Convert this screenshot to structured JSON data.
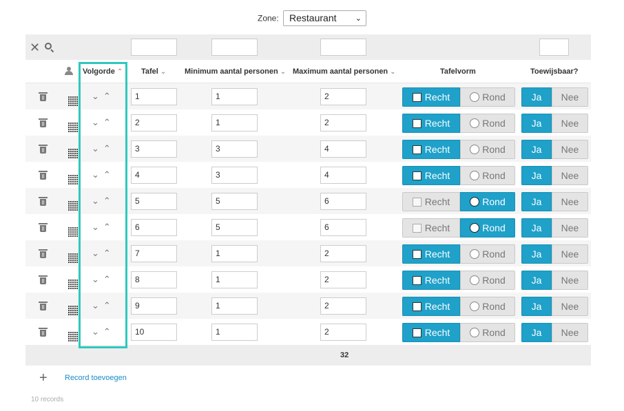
{
  "zone": {
    "label": "Zone:",
    "selected": "Restaurant"
  },
  "headers": {
    "volgorde": "Volgorde",
    "tafel": "Tafel",
    "min": "Minimum aantal personen",
    "max": "Maximum aantal personen",
    "tafelvorm": "Tafelvorm",
    "toewijsbaar": "Toewijsbaar?"
  },
  "options": {
    "recht": "Recht",
    "rond": "Rond",
    "ja": "Ja",
    "nee": "Nee"
  },
  "rows": [
    {
      "tafel": "1",
      "min": "1",
      "max": "2",
      "vorm": "Recht",
      "toewijsbaar": "Ja"
    },
    {
      "tafel": "2",
      "min": "1",
      "max": "2",
      "vorm": "Recht",
      "toewijsbaar": "Ja"
    },
    {
      "tafel": "3",
      "min": "3",
      "max": "4",
      "vorm": "Recht",
      "toewijsbaar": "Ja"
    },
    {
      "tafel": "4",
      "min": "3",
      "max": "4",
      "vorm": "Recht",
      "toewijsbaar": "Ja"
    },
    {
      "tafel": "5",
      "min": "5",
      "max": "6",
      "vorm": "Rond",
      "toewijsbaar": "Ja"
    },
    {
      "tafel": "6",
      "min": "5",
      "max": "6",
      "vorm": "Rond",
      "toewijsbaar": "Ja"
    },
    {
      "tafel": "7",
      "min": "1",
      "max": "2",
      "vorm": "Recht",
      "toewijsbaar": "Ja"
    },
    {
      "tafel": "8",
      "min": "1",
      "max": "2",
      "vorm": "Recht",
      "toewijsbaar": "Ja"
    },
    {
      "tafel": "9",
      "min": "1",
      "max": "2",
      "vorm": "Recht",
      "toewijsbaar": "Ja"
    },
    {
      "tafel": "10",
      "min": "1",
      "max": "2",
      "vorm": "Recht",
      "toewijsbaar": "Ja"
    }
  ],
  "footer": {
    "total": "32"
  },
  "add_record": "Record toevoegen",
  "records_count": "10 records",
  "colors": {
    "accent": "#1fa1c9",
    "highlight": "#2fc8bd"
  },
  "icons": [
    "close-icon",
    "search-icon",
    "user-icon",
    "trash-icon",
    "qr-code-icon",
    "chevron-down-icon",
    "chevron-up-icon",
    "plus-icon"
  ]
}
